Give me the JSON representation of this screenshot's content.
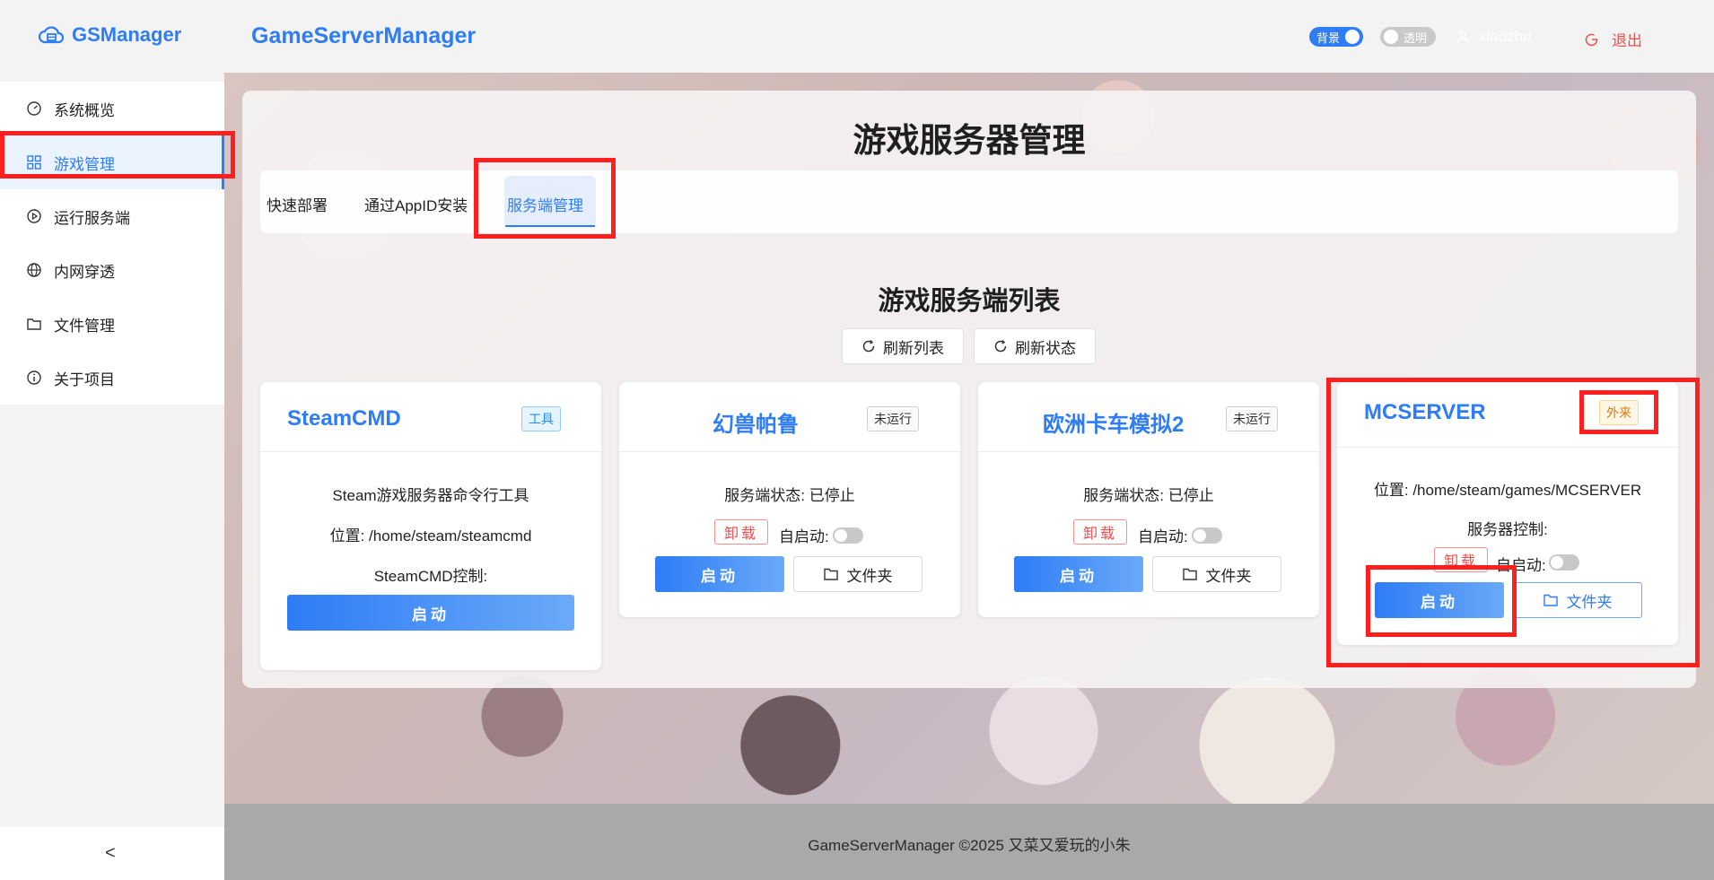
{
  "header": {
    "logo_text": "GSManager",
    "app_title": "GameServerManager",
    "bg_toggle_label": "背景",
    "transparent_toggle_label": "透明",
    "username": "xiaozhu",
    "logout_label": "退出"
  },
  "sidebar": {
    "items": [
      {
        "label": "系统概览",
        "icon": "dashboard-icon"
      },
      {
        "label": "游戏管理",
        "icon": "grid-icon"
      },
      {
        "label": "运行服务端",
        "icon": "play-circle-icon"
      },
      {
        "label": "内网穿透",
        "icon": "globe-icon"
      },
      {
        "label": "文件管理",
        "icon": "folder-icon"
      },
      {
        "label": "关于项目",
        "icon": "info-icon"
      }
    ],
    "active_index": 1,
    "collapse_glyph": "<"
  },
  "page": {
    "title": "游戏服务器管理",
    "tabs": [
      "快速部署",
      "通过AppID安装",
      "服务端管理"
    ],
    "active_tab": "服务端管理",
    "list_title": "游戏服务端列表",
    "refresh_list_label": "刷新列表",
    "refresh_status_label": "刷新状态"
  },
  "cards": [
    {
      "name": "SteamCMD",
      "tag": "工具",
      "description": "Steam游戏服务器命令行工具",
      "location": "位置: /home/steam/steamcmd",
      "control_label": "SteamCMD控制:",
      "start_label": "启动"
    },
    {
      "name": "幻兽帕鲁",
      "tag": "未运行",
      "status": "服务端状态: 已停止",
      "uninstall_label": "卸载",
      "autostart_label": "自启动:",
      "autostart_on": false,
      "start_label": "启动",
      "folder_label": "文件夹"
    },
    {
      "name": "欧洲卡车模拟2",
      "tag": "未运行",
      "status": "服务端状态: 已停止",
      "uninstall_label": "卸载",
      "autostart_label": "自启动:",
      "autostart_on": false,
      "start_label": "启动",
      "folder_label": "文件夹"
    },
    {
      "name": "MCSERVER",
      "tag": "外来",
      "location": "位置: /home/steam/games/MCSERVER",
      "control_label": "服务器控制:",
      "uninstall_label": "卸载",
      "autostart_label": "自启动:",
      "autostart_on": false,
      "start_label": "启动",
      "folder_label": "文件夹"
    }
  ],
  "footer": {
    "text": "GameServerManager ©2025 又菜又爱玩的小朱"
  },
  "colors": {
    "accent": "#2e7cf6",
    "danger": "#f04d4d",
    "highlight": "#ff1f1f"
  }
}
